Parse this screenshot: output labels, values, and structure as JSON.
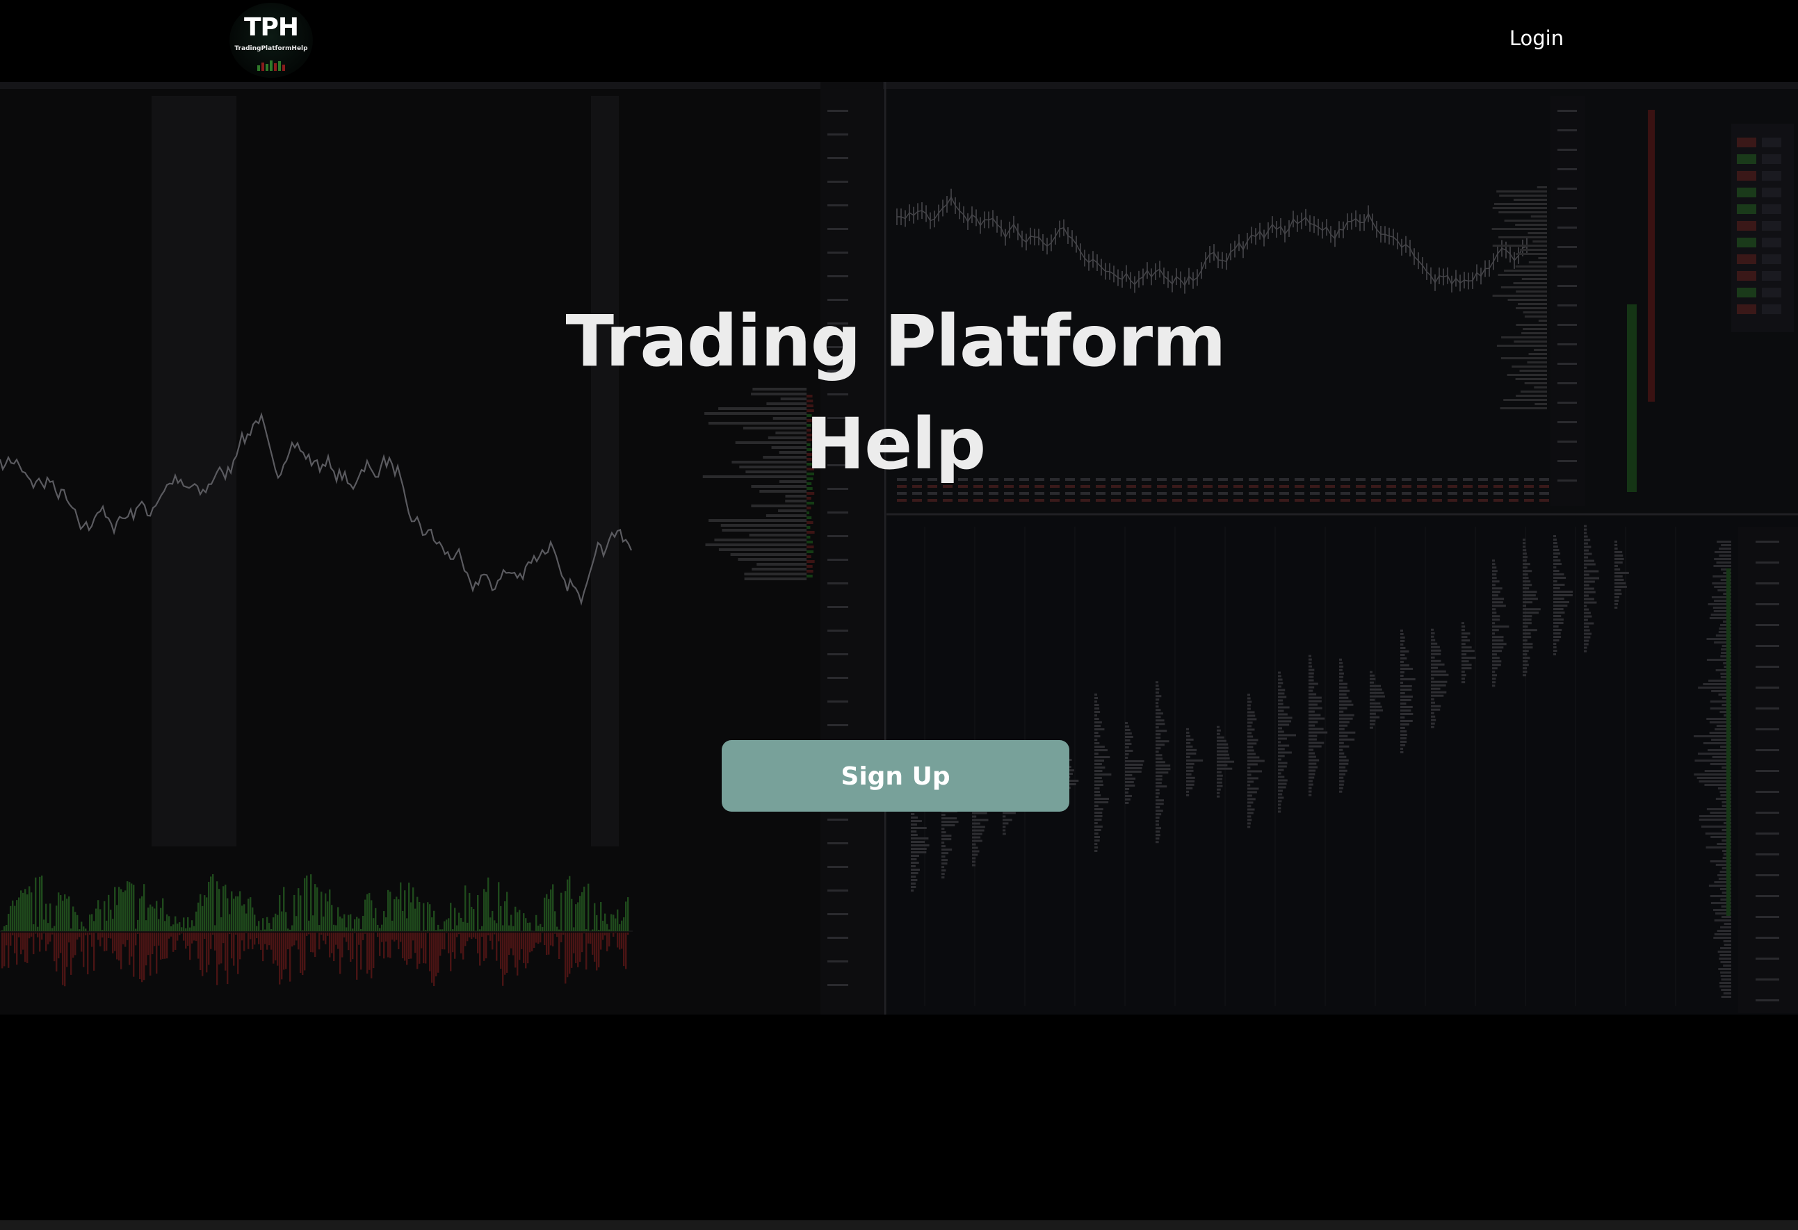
{
  "header": {
    "logo_text": "TPH",
    "logo_subtext": "TradingPlatformHelp",
    "login_label": "Login"
  },
  "hero": {
    "title": "Trading Platform Help",
    "signup_label": "Sign Up"
  },
  "colors": {
    "background": "#000000",
    "signup_button": "#78a19a",
    "title_text": "#ececec",
    "chart_up": "#2f7a2a",
    "chart_down": "#8a1c1c"
  }
}
